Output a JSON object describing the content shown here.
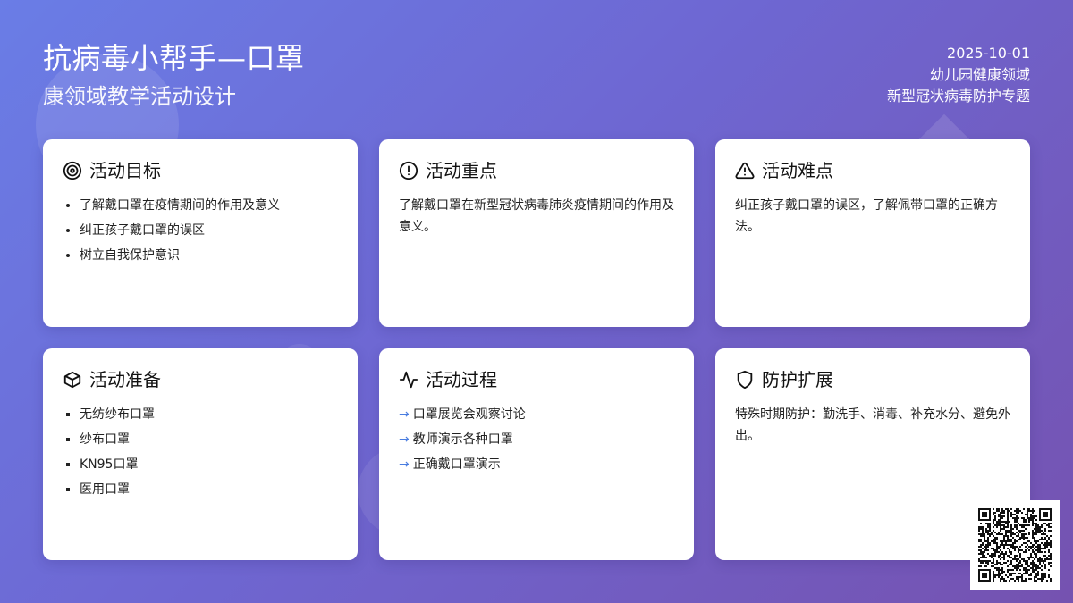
{
  "header": {
    "title": "抗病毒小帮手—口罩",
    "subtitle": "康领域教学活动设计",
    "date": "2025-10-01",
    "category": "幼儿园健康领域",
    "topic": "新型冠状病毒防护专题"
  },
  "cards": {
    "goals": {
      "title": "活动目标",
      "icon": "target-icon",
      "items": [
        "了解戴口罩在疫情期间的作用及意义",
        "纠正孩子戴口罩的误区",
        "树立自我保护意识"
      ]
    },
    "key_points": {
      "title": "活动重点",
      "icon": "alert-circle-icon",
      "text": "了解戴口罩在新型冠状病毒肺炎疫情期间的作用及意义。"
    },
    "difficulties": {
      "title": "活动难点",
      "icon": "warning-triangle-icon",
      "text": "纠正孩子戴口罩的误区，了解佩带口罩的正确方法。"
    },
    "preparation": {
      "title": "活动准备",
      "icon": "box-icon",
      "items": [
        "无纺纱布口罩",
        "纱布口罩",
        "KN95口罩",
        "医用口罩"
      ]
    },
    "process": {
      "title": "活动过程",
      "icon": "activity-icon",
      "arrow": "→",
      "items": [
        "口罩展览会观察讨论",
        "教师演示各种口罩",
        "正确戴口罩演示"
      ]
    },
    "extension": {
      "title": "防护扩展",
      "icon": "shield-icon",
      "text": "特殊时期防护：勤洗手、消毒、补充水分、避免外出。"
    }
  },
  "colors": {
    "accent": "#4a7de0",
    "bg_start": "#6a7de6",
    "bg_end": "#7552b0"
  }
}
